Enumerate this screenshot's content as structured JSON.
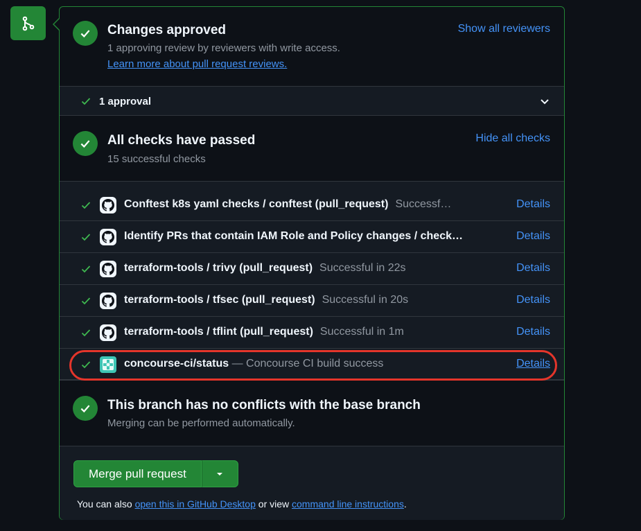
{
  "approved": {
    "title": "Changes approved",
    "subtitle": "1 approving review by reviewers with write access.",
    "learn_link": "Learn more about pull request reviews.",
    "show_reviewers": "Show all reviewers",
    "approval_count": "1 approval"
  },
  "checks": {
    "title": "All checks have passed",
    "subtitle": "15 successful checks",
    "hide_link": "Hide all checks",
    "items": [
      {
        "name": "Conftest k8s yaml checks / conftest (pull_request)",
        "status": "Successf…",
        "details": "Details"
      },
      {
        "name": "Identify PRs that contain IAM Role and Policy changes / check…",
        "status": "",
        "details": "Details"
      },
      {
        "name": "terraform-tools / trivy (pull_request)",
        "status": "Successful in 22s",
        "details": "Details"
      },
      {
        "name": "terraform-tools / tfsec (pull_request)",
        "status": "Successful in 20s",
        "details": "Details"
      },
      {
        "name": "terraform-tools / tflint (pull_request)",
        "status": "Successful in 1m",
        "details": "Details"
      },
      {
        "name": "concourse-ci/status",
        "status": "— Concourse CI build success",
        "details": "Details"
      }
    ]
  },
  "conflicts": {
    "title": "This branch has no conflicts with the base branch",
    "subtitle": "Merging can be performed automatically."
  },
  "merge": {
    "button": "Merge pull request",
    "note_prefix": "You can also ",
    "desktop_link": "open this in GitHub Desktop",
    "note_middle": " or view ",
    "cli_link": "command line instructions",
    "note_suffix": "."
  },
  "colors": {
    "success": "#238636",
    "link": "#4493f8",
    "highlight": "#e5352b"
  }
}
